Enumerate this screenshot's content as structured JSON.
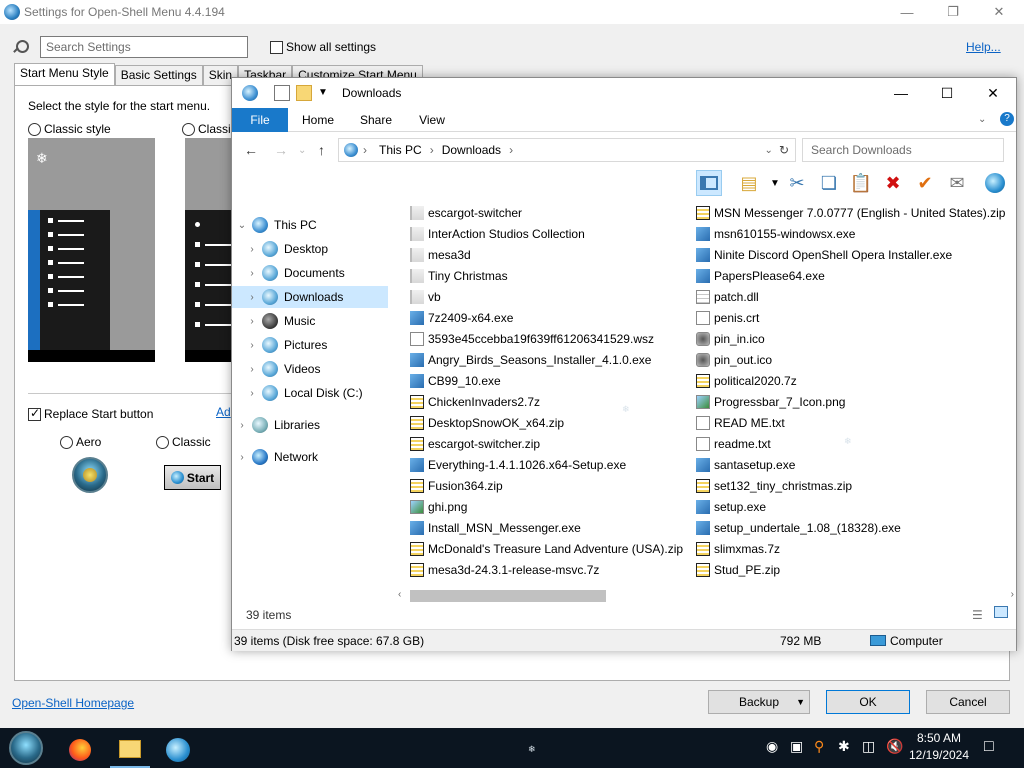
{
  "settings": {
    "title": "Settings for Open-Shell Menu 4.4.194",
    "search_placeholder": "Search Settings",
    "show_all": "Show all settings",
    "help": "Help...",
    "tabs": [
      "Start Menu Style",
      "Basic Settings",
      "Skin",
      "Taskbar",
      "Customize Start Menu"
    ],
    "select_label": "Select the style for the start menu.",
    "style_classic": "Classic style",
    "style_classic2": "Classic",
    "replace_start": "Replace Start button",
    "add_link": "Ad",
    "btn_aero": "Aero",
    "btn_classic": "Classic",
    "start_label": "Start",
    "homepage": "Open-Shell Homepage",
    "backup": "Backup",
    "ok": "OK",
    "cancel": "Cancel"
  },
  "explorer": {
    "title": "Downloads",
    "ribbon_tabs": [
      "File",
      "Home",
      "Share",
      "View"
    ],
    "breadcrumb": [
      "This PC",
      "Downloads"
    ],
    "search_placeholder": "Search Downloads",
    "nav": [
      {
        "label": "This PC",
        "icon": "computer-icon"
      },
      {
        "label": "Desktop",
        "icon": "desktop-icon"
      },
      {
        "label": "Documents",
        "icon": "documents-icon"
      },
      {
        "label": "Downloads",
        "icon": "downloads-icon"
      },
      {
        "label": "Music",
        "icon": "music-icon"
      },
      {
        "label": "Pictures",
        "icon": "pictures-icon"
      },
      {
        "label": "Videos",
        "icon": "videos-icon"
      },
      {
        "label": "Local Disk (C:)",
        "icon": "disk-icon"
      },
      {
        "label": "Libraries",
        "icon": "libraries-icon"
      },
      {
        "label": "Network",
        "icon": "network-icon"
      }
    ],
    "files_col1": [
      {
        "name": "escargot-switcher",
        "type": "folder"
      },
      {
        "name": "InterAction Studios Collection",
        "type": "folder"
      },
      {
        "name": "mesa3d",
        "type": "folder"
      },
      {
        "name": "Tiny Christmas",
        "type": "folder"
      },
      {
        "name": "vb",
        "type": "folder"
      },
      {
        "name": "7z2409-x64.exe",
        "type": "exe"
      },
      {
        "name": "3593e45ccebba19f639ff61206341529.wsz",
        "type": "txt"
      },
      {
        "name": "Angry_Birds_Seasons_Installer_4.1.0.exe",
        "type": "exe"
      },
      {
        "name": "CB99_10.exe",
        "type": "exe"
      },
      {
        "name": "ChickenInvaders2.7z",
        "type": "zip"
      },
      {
        "name": "DesktopSnowOK_x64.zip",
        "type": "zip"
      },
      {
        "name": "escargot-switcher.zip",
        "type": "zip"
      },
      {
        "name": "Everything-1.4.1.1026.x64-Setup.exe",
        "type": "exe"
      },
      {
        "name": "Fusion364.zip",
        "type": "zip"
      },
      {
        "name": "ghi.png",
        "type": "img"
      },
      {
        "name": "Install_MSN_Messenger.exe",
        "type": "exe"
      },
      {
        "name": "McDonald's Treasure Land Adventure (USA).zip",
        "type": "zip"
      },
      {
        "name": "mesa3d-24.3.1-release-msvc.7z",
        "type": "zip"
      }
    ],
    "files_col2": [
      {
        "name": "MSN Messenger 7.0.0777 (English - United States).zip",
        "type": "zip"
      },
      {
        "name": "msn610155-windowsx.exe",
        "type": "exe"
      },
      {
        "name": "Ninite Discord OpenShell Opera Installer.exe",
        "type": "exe"
      },
      {
        "name": "PapersPlease64.exe",
        "type": "exe"
      },
      {
        "name": "patch.dll",
        "type": "dll"
      },
      {
        "name": "penis.crt",
        "type": "txt"
      },
      {
        "name": "pin_in.ico",
        "type": "ico"
      },
      {
        "name": "pin_out.ico",
        "type": "ico"
      },
      {
        "name": "political2020.7z",
        "type": "zip"
      },
      {
        "name": "Progressbar_7_Icon.png",
        "type": "img"
      },
      {
        "name": "READ ME.txt",
        "type": "txt"
      },
      {
        "name": "readme.txt",
        "type": "txt"
      },
      {
        "name": "santasetup.exe",
        "type": "exe"
      },
      {
        "name": "set132_tiny_christmas.zip",
        "type": "zip"
      },
      {
        "name": "setup.exe",
        "type": "exe"
      },
      {
        "name": "setup_undertale_1.08_(18328).exe",
        "type": "exe"
      },
      {
        "name": "slimxmas.7z",
        "type": "zip"
      },
      {
        "name": "Stud_PE.zip",
        "type": "zip"
      }
    ],
    "item_count": "39 items",
    "status_left": "39 items (Disk free space: 67.8 GB)",
    "status_size": "792 MB",
    "status_location": "Computer"
  },
  "taskbar": {
    "time": "8:50 AM",
    "date": "12/19/2024"
  }
}
